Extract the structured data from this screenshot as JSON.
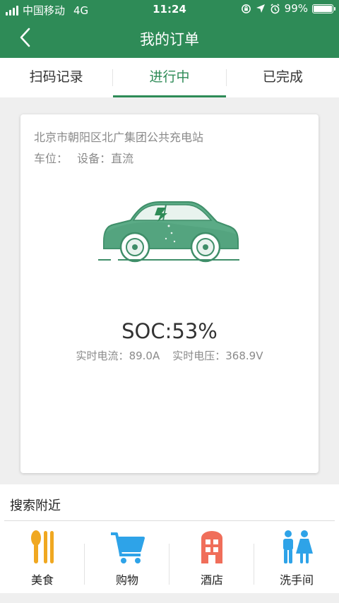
{
  "status_bar": {
    "carrier": "中国移动",
    "network": "4G",
    "time": "11:24",
    "battery": "99%",
    "battery_level": 0.99
  },
  "header": {
    "title": "我的订单"
  },
  "tabs": [
    {
      "label": "扫码记录",
      "active": false
    },
    {
      "label": "进行中",
      "active": true
    },
    {
      "label": "已完成",
      "active": false
    }
  ],
  "order": {
    "station": "北京市朝阳区北广集团公共充电站",
    "slot_label": "车位：",
    "device_label": "设备：直流",
    "soc_label": "SOC:",
    "soc_value": "53%",
    "current_label": "实时电流：",
    "current_value": "89.0A",
    "voltage_label": "实时电压：",
    "voltage_value": "368.9V"
  },
  "nearby": {
    "title": "搜索附近",
    "items": [
      {
        "label": "美食",
        "icon": "fork-knife-icon",
        "color": "#f0a821"
      },
      {
        "label": "购物",
        "icon": "shopping-cart-icon",
        "color": "#2ea3e8"
      },
      {
        "label": "酒店",
        "icon": "hotel-icon",
        "color": "#f06e5a"
      },
      {
        "label": "洗手间",
        "icon": "restroom-icon",
        "color": "#2ea3e8"
      }
    ]
  },
  "colors": {
    "primary": "#2e8b57",
    "car": "#5bab86"
  }
}
